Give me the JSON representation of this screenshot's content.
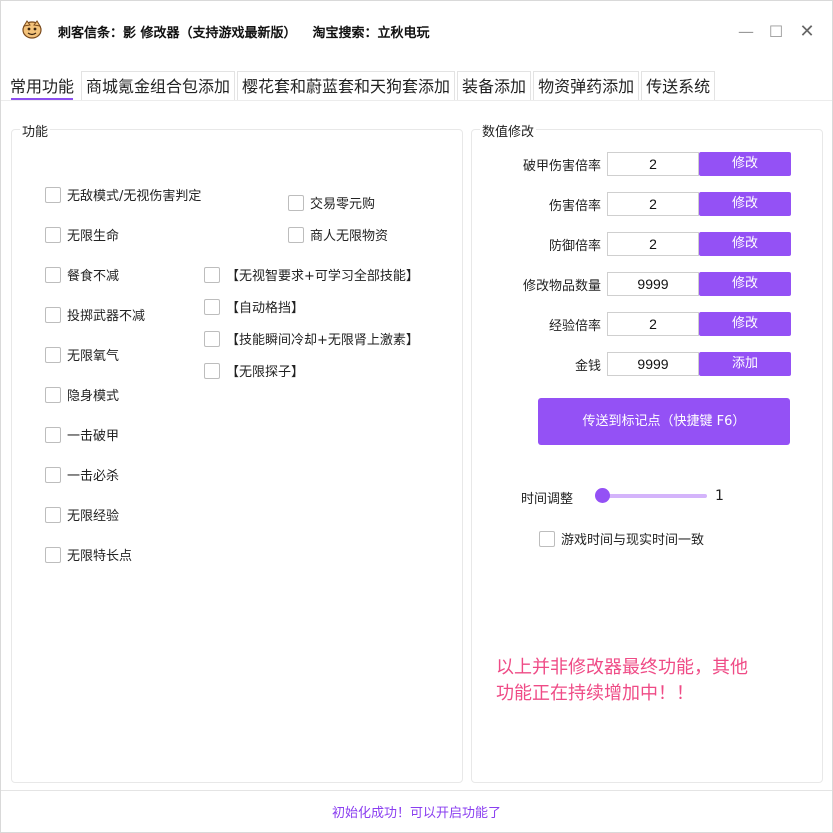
{
  "window": {
    "title_part1": "刺客信条：影 修改器（支持游戏最新版）",
    "title_part2": "淘宝搜索：立秋电玩",
    "minimize_glyph": "—",
    "maximize_glyph": "☐",
    "close_glyph": "✕"
  },
  "tabs": [
    {
      "label": "常用功能"
    },
    {
      "label": "商城氪金组合包添加"
    },
    {
      "label": "樱花套和蔚蓝套和天狗套添加"
    },
    {
      "label": "装备添加"
    },
    {
      "label": "物资弹药添加"
    },
    {
      "label": "传送系统"
    }
  ],
  "functions": {
    "group_title": "功能",
    "col1": [
      "无敌模式/无视伤害判定",
      "无限生命",
      "餐食不减",
      "投掷武器不减",
      "无限氧气",
      "隐身模式",
      "一击破甲",
      "一击必杀",
      "无限经验",
      "无限特长点"
    ],
    "col2": [
      "【无视智要求+可学习全部技能】",
      "【自动格挡】",
      "【技能瞬间冷却+无限肾上激素】",
      "【无限探子】"
    ],
    "col3": [
      "交易零元购",
      "商人无限物资"
    ]
  },
  "values": {
    "group_title": "数值修改",
    "rows": [
      {
        "label": "破甲伤害倍率",
        "value": "2",
        "button": "修改"
      },
      {
        "label": "伤害倍率",
        "value": "2",
        "button": "修改"
      },
      {
        "label": "防御倍率",
        "value": "2",
        "button": "修改"
      },
      {
        "label": "修改物品数量",
        "value": "9999",
        "button": "修改"
      },
      {
        "label": "经验倍率",
        "value": "2",
        "button": "修改"
      },
      {
        "label": "金钱",
        "value": "9999",
        "button": "添加"
      }
    ],
    "teleport_button": "传送到标记点（快捷键 F6）",
    "time_label": "时间调整",
    "time_value": "1",
    "time_slider_level": 0,
    "sync_time_label": "游戏时间与现实时间一致"
  },
  "notice_line1": "以上并非修改器最终功能，其他",
  "notice_line2": "功能正在持续增加中！！",
  "status": "初始化成功！可以开启功能了",
  "colors": {
    "accent": "#9451f5",
    "notice": "#ef4b86",
    "status": "#8a3ef0"
  },
  "icons": {
    "app": "cartoon-face-icon"
  }
}
